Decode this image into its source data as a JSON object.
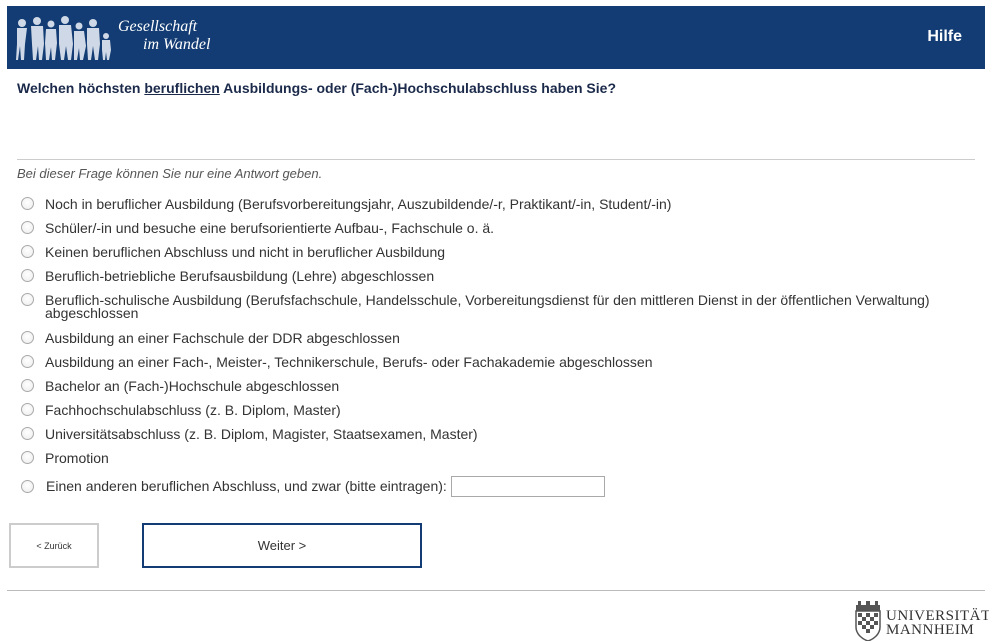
{
  "header": {
    "logo_line1": "Gesellschaft",
    "logo_line2": "im Wandel",
    "help_label": "Hilfe",
    "background_color": "#123c73"
  },
  "question": {
    "prefix": "Welchen höchsten ",
    "underlined": "beruflichen",
    "suffix": " Ausbildungs- oder (Fach-)Hochschulabschluss haben Sie?"
  },
  "instruction": "Bei dieser Frage können Sie nur eine Antwort geben.",
  "options": [
    "Noch in beruflicher Ausbildung (Berufsvorbereitungsjahr, Auszubildende/-r, Praktikant/-in, Student/-in)",
    "Schüler/-in und besuche eine berufsorientierte Aufbau-, Fachschule o. ä.",
    "Keinen beruflichen Abschluss und nicht in beruflicher Ausbildung",
    "Beruflich-betriebliche Berufsausbildung (Lehre) abgeschlossen",
    "Beruflich-schulische Ausbildung (Berufsfachschule, Handelsschule, Vorbereitungsdienst für den mittleren Dienst in der öffentlichen Verwaltung) abgeschlossen",
    "Ausbildung an einer Fachschule der DDR abgeschlossen",
    "Ausbildung an einer Fach-, Meister-, Technikerschule, Berufs- oder Fachakademie abgeschlossen",
    "Bachelor an (Fach-)Hochschule abgeschlossen",
    "Fachhochschulabschluss (z. B. Diplom, Master)",
    "Universitätsabschluss (z. B. Diplom, Magister, Staatsexamen, Master)",
    "Promotion",
    "Einen anderen beruflichen Abschluss, und zwar (bitte eintragen):"
  ],
  "other_input_value": "",
  "buttons": {
    "back_label": "< Zurück",
    "next_label": "Weiter >"
  },
  "footer": {
    "uni_line1": "UNIVERSITÄT",
    "uni_line2": "MANNHEIM"
  }
}
